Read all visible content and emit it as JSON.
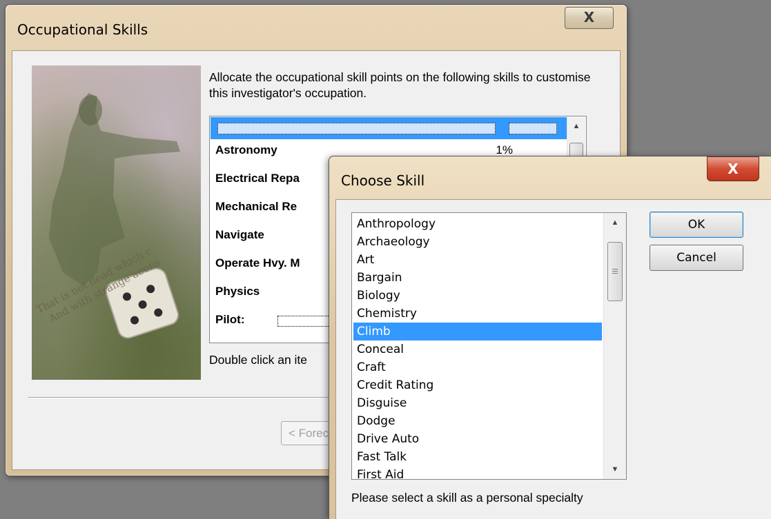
{
  "occupational_window": {
    "title": "Occupational Skills",
    "close_label": "X",
    "instructions": "Allocate the occupational skill points on the following skills to customise this investigator's occupation.",
    "image_caption_line1": "That is not dead which c",
    "image_caption_line2": "And with strange aeons",
    "skills": [
      {
        "name": "Astronomy",
        "percent": "1%"
      },
      {
        "name": "Electrical Repa",
        "percent": ""
      },
      {
        "name": "Mechanical Re",
        "percent": ""
      },
      {
        "name": "Navigate",
        "percent": ""
      },
      {
        "name": "Operate Hvy. M",
        "percent": ""
      },
      {
        "name": "Physics",
        "percent": ""
      },
      {
        "name": "Pilot:",
        "percent": ""
      }
    ],
    "footer_text": "Double click an ite",
    "prev_button_label": "< Forec"
  },
  "choose_skill_window": {
    "title": "Choose Skill",
    "close_label": "X",
    "options": [
      "Anthropology",
      "Archaeology",
      "Art",
      "Bargain",
      "Biology",
      "Chemistry",
      "Climb",
      "Conceal",
      "Craft",
      "Credit Rating",
      "Disguise",
      "Dodge",
      "Drive Auto",
      "Fast Talk",
      "First Aid"
    ],
    "selected_option": "Climb",
    "ok_label": "OK",
    "cancel_label": "Cancel",
    "hint": "Please select a skill as a personal specialty"
  },
  "colors": {
    "selection": "#3399ff",
    "close_button_red": "#c1341e",
    "desktop": "#7f7f7f"
  }
}
